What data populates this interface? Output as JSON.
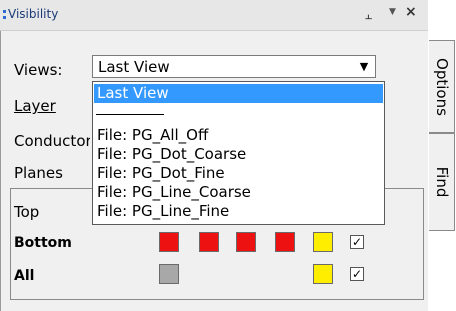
{
  "panel": {
    "title": "Visibility",
    "pin_icon": "pin-icon",
    "menu_icon": "chevron-down-icon",
    "close_icon": "close-icon"
  },
  "form": {
    "views_label": "Views:",
    "layer_label": "Layer",
    "conductors_label": "Conductors",
    "planes_label": "Planes",
    "views_value": "Last View"
  },
  "dropdown": {
    "options": [
      {
        "label": "Last View",
        "selected": true
      },
      {
        "label": "",
        "separator": true
      },
      {
        "label": "File: PG_All_Off"
      },
      {
        "label": "File: PG_Dot_Coarse"
      },
      {
        "label": "File: PG_Dot_Fine"
      },
      {
        "label": "File: PG_Line_Coarse"
      },
      {
        "label": "File: PG_Line_Fine"
      }
    ]
  },
  "planes": {
    "rows": [
      {
        "label": "Top"
      },
      {
        "label": "Bottom",
        "swatches": [
          "red",
          "red",
          "red",
          "red",
          "yellow"
        ],
        "checked": true
      },
      {
        "label": "All",
        "swatches": [
          "gray",
          "yellow"
        ],
        "checked": true
      }
    ],
    "colors": {
      "red": "#ee1111",
      "yellow": "#ffee00",
      "gray": "#a8a8a8"
    }
  },
  "side_tabs": [
    {
      "label": "Options"
    },
    {
      "label": "Find"
    }
  ]
}
